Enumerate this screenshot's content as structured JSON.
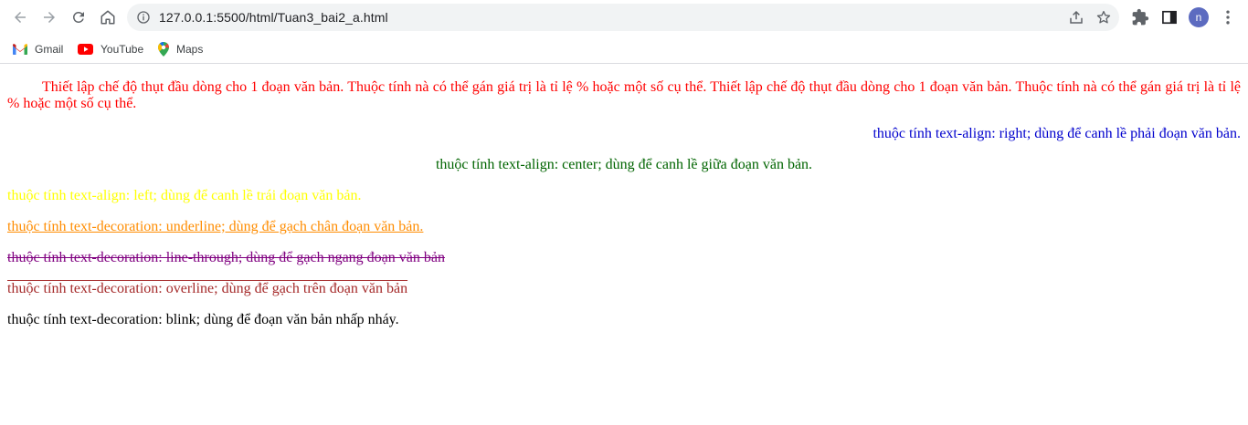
{
  "browser": {
    "url": "127.0.0.1:5500/html/Tuan3_bai2_a.html",
    "profile_initial": "n",
    "icons": {
      "back": "arrow-left-icon",
      "forward": "arrow-right-icon",
      "reload": "reload-icon",
      "home": "home-icon",
      "info": "info-icon",
      "share": "share-icon",
      "bookmark": "star-icon",
      "extensions": "puzzle-icon",
      "sidepanel": "side-panel-icon",
      "menu": "kebab-menu-icon"
    },
    "bookmarks": [
      {
        "label": "Gmail",
        "icon": "gmail-icon"
      },
      {
        "label": "YouTube",
        "icon": "youtube-icon"
      },
      {
        "label": "Maps",
        "icon": "maps-icon"
      }
    ]
  },
  "page": {
    "paragraphs": {
      "indent": "Thiết lập chế độ thụt đầu dòng cho 1 đoạn văn bản. Thuộc tính nà có thể gán giá trị là tỉ lệ % hoặc một số cụ thể. Thiết lập chế độ thụt đầu dòng cho 1 đoạn văn bản. Thuộc tính nà có thể gán giá trị là tỉ lệ % hoặc một số cụ thể.",
      "right": "thuộc tính text-align: right; dùng để canh lề phải đoạn văn bản.",
      "center": "thuộc tính text-align: center; dùng để canh lề giữa đoạn văn bản.",
      "left": "thuộc tính text-align: left; dùng để canh lề trái đoạn văn bản.",
      "underline": "thuộc tính text-decoration: underline; dùng để gạch chân đoạn văn bản.",
      "line_through": "thuộc tính text-decoration: line-through; dùng để gạch ngang đoạn văn bản",
      "overline": "thuộc tính text-decoration: overline; dùng để gạch trên đoạn văn bản",
      "blink": "thuộc tính text-decoration: blink; dùng để đoạn văn bản nhấp nháy."
    },
    "colors": {
      "indent": "#ff0000",
      "right": "#0000cd",
      "center": "#006400",
      "left": "#ffff00",
      "underline": "#ff8c00",
      "line_through": "#800080",
      "overline": "#a52a2a",
      "blink": "#000000"
    }
  }
}
